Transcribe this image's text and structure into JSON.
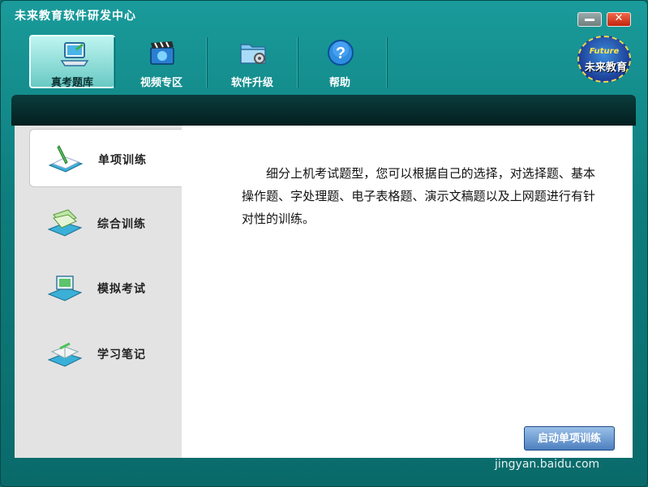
{
  "window": {
    "title": "未来教育软件研发中心"
  },
  "toolbar": {
    "items": [
      {
        "label": "真考题库",
        "icon": "laptop-icon",
        "active": true
      },
      {
        "label": "视频专区",
        "icon": "clapperboard-icon",
        "active": false
      },
      {
        "label": "软件升级",
        "icon": "folder-gear-icon",
        "active": false
      },
      {
        "label": "帮助",
        "icon": "help-icon",
        "active": false
      }
    ]
  },
  "brand": {
    "en": "Future",
    "cn": "未来教育"
  },
  "sidebar": {
    "items": [
      {
        "label": "单项训练",
        "icon": "pencil-book-icon",
        "active": true
      },
      {
        "label": "综合训练",
        "icon": "books-icon",
        "active": false
      },
      {
        "label": "模拟考试",
        "icon": "exam-icon",
        "active": false
      },
      {
        "label": "学习笔记",
        "icon": "notes-icon",
        "active": false
      }
    ]
  },
  "content": {
    "description": "细分上机考试题型，您可以根据自己的选择，对选择题、基本操作题、字处理题、电子表格题、演示文稿题以及上网题进行有针对性的训练。",
    "start_button": "启动单项训练"
  },
  "watermark": "jingyan.baidu.com",
  "colors": {
    "frame": "#0e7d7d",
    "dark_band": "#062a2a",
    "accent_button": "#4d7fbf"
  }
}
